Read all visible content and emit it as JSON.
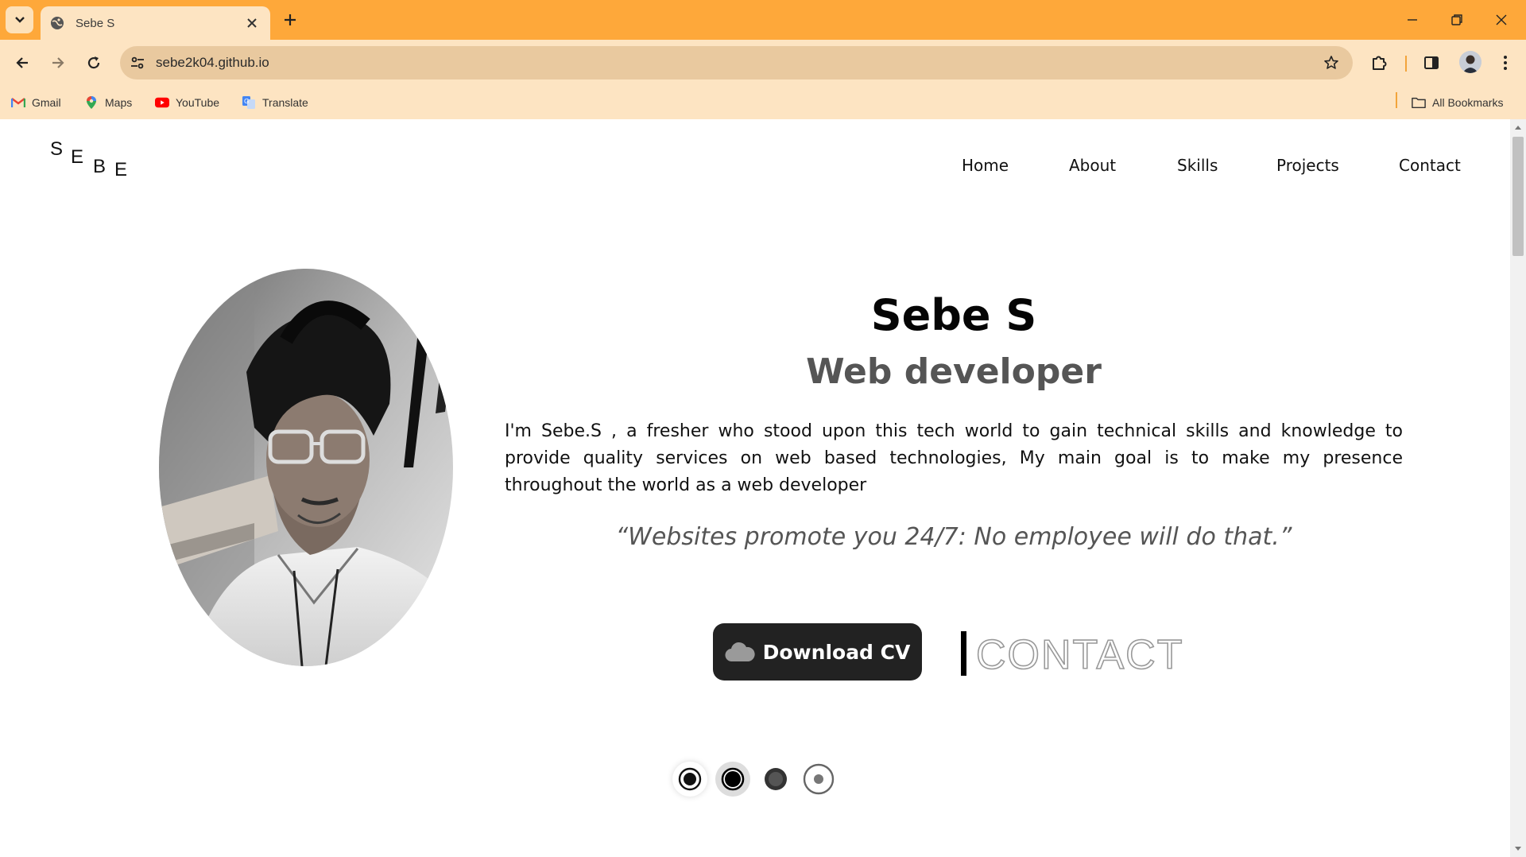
{
  "browser": {
    "tab_title": "Sebe S",
    "url": "sebe2k04.github.io",
    "bookmarks": [
      {
        "label": "Gmail",
        "icon": "gmail-icon"
      },
      {
        "label": "Maps",
        "icon": "maps-icon"
      },
      {
        "label": "YouTube",
        "icon": "youtube-icon"
      },
      {
        "label": "Translate",
        "icon": "translate-icon"
      }
    ],
    "all_bookmarks": "All Bookmarks",
    "theme_color": "#fea83a"
  },
  "site": {
    "logo": [
      "S",
      "E",
      "B",
      "E"
    ],
    "nav": [
      "Home",
      "About",
      "Skills",
      "Projects",
      "Contact"
    ]
  },
  "hero": {
    "name": "Sebe S",
    "role": "Web developer",
    "description": "I'm Sebe.S , a fresher who stood upon this tech world to gain technical skills and knowledge to provide quality services on web based technologies, My main goal is to make my presence throughout the world as a web developer",
    "quote": "“Websites promote you 24/7: No employee will do that.”",
    "download_cv": "Download CV",
    "contact": "CONTACT"
  },
  "social_icons": [
    "social-icon-1",
    "social-icon-2",
    "social-icon-3",
    "social-icon-4"
  ]
}
